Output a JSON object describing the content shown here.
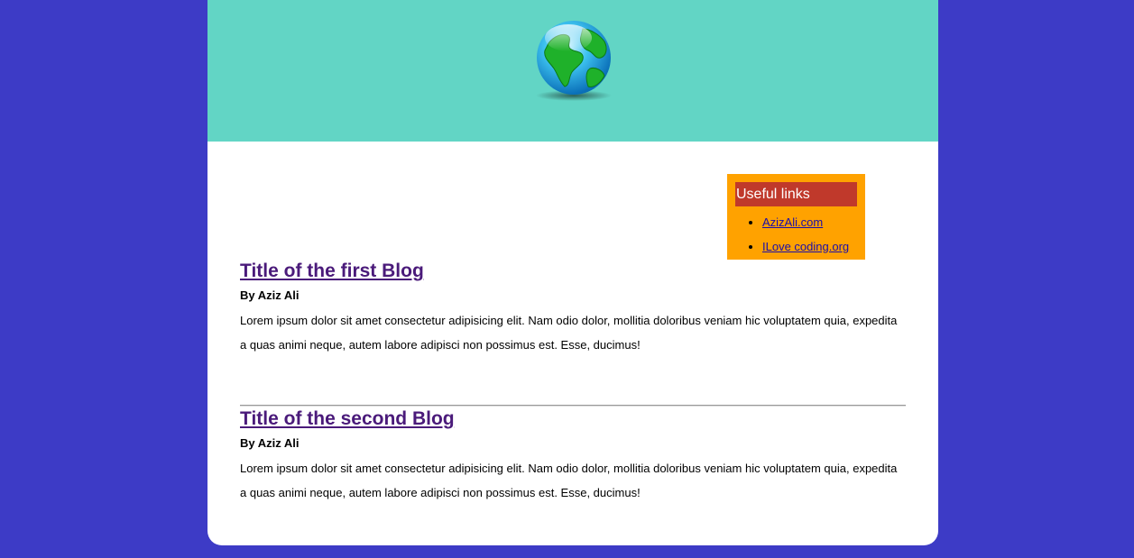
{
  "header": {
    "logo_icon": "globe-icon"
  },
  "sidebar": {
    "title": "Useful links",
    "links": [
      {
        "label": "AzizAli.com"
      },
      {
        "label": "ILove coding.org"
      }
    ]
  },
  "posts": [
    {
      "title": "Title of the first Blog",
      "author": "By Aziz Ali",
      "body": "Lorem ipsum dolor sit amet consectetur adipisicing elit. Nam odio dolor, mollitia doloribus veniam hic voluptatem quia, expedita a quas animi neque, autem labore adipisci non possimus est. Esse, ducimus!"
    },
    {
      "title": "Title of the second Blog",
      "author": "By Aziz Ali",
      "body": "Lorem ipsum dolor sit amet consectetur adipisicing elit. Nam odio dolor, mollitia doloribus veniam hic voluptatem quia, expedita a quas animi neque, autem labore adipisci non possimus est. Esse, ducimus!"
    }
  ],
  "colors": {
    "background": "#3d3bc6",
    "header": "#62d5c5",
    "sidebar": "#ffa200",
    "sidebar_title": "#c0392b",
    "post_title": "#4a1a7a"
  }
}
